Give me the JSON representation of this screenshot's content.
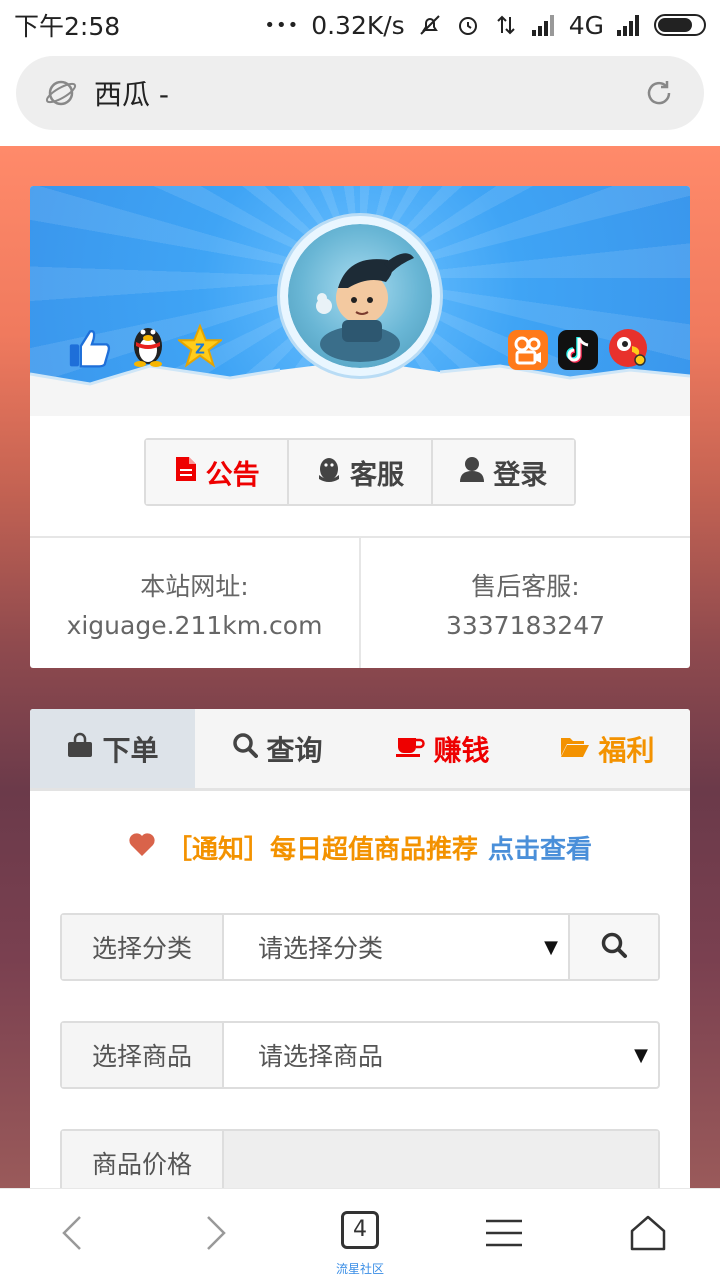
{
  "status_bar": {
    "time": "下午2:58",
    "net_speed": "0.32K/s",
    "network": "4G",
    "dots": "•••"
  },
  "browser": {
    "url_text": "西瓜 -"
  },
  "banner": {
    "left_icons": [
      "thumbs-up-icon",
      "qq-penguin-icon",
      "qzone-star-icon"
    ],
    "right_icons": [
      "kuaishou-icon",
      "douyin-icon",
      "parrot-app-icon"
    ]
  },
  "nav": {
    "announcement": "公告",
    "service": "客服",
    "login": "登录"
  },
  "info": {
    "site_label": "本站网址:",
    "site_value": "xiguage.211km.com",
    "support_label": "售后客服:",
    "support_value": "3337183247"
  },
  "tabs": {
    "order": "下单",
    "query": "查询",
    "earn": "赚钱",
    "welfare": "福利"
  },
  "notice": {
    "text": "［通知］每日超值商品推荐",
    "link": "点击查看"
  },
  "form": {
    "category_label": "选择分类",
    "category_value": "请选择分类",
    "product_label": "选择商品",
    "product_value": "请选择商品",
    "price_label": "商品价格",
    "price_value": ""
  },
  "bottom_nav": {
    "tab_count": "4",
    "caption": "流星社区"
  },
  "colors": {
    "accent_red": "#e00000",
    "accent_orange": "#f39200",
    "link_blue": "#4a8fd9",
    "banner_blue": "#3fa4f5"
  }
}
